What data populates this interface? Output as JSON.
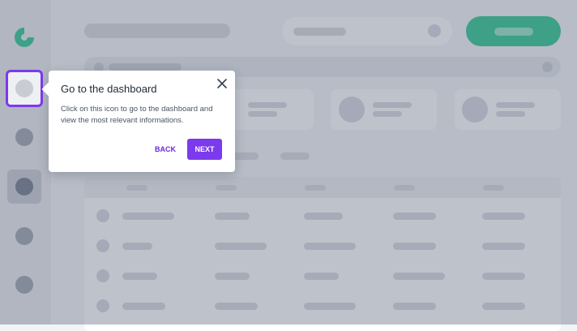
{
  "tour": {
    "title": "Go to the dashboard",
    "description": "Click on this icon to go to the dashboard and view the most relevant informations.",
    "back_label": "BACK",
    "next_label": "NEXT"
  },
  "colors": {
    "accent": "#7c3aed",
    "logo": "#22c58b",
    "primary_button": "#22c58b"
  },
  "icons": {
    "logo": "app-logo",
    "close": "close-icon"
  },
  "sidebar": {
    "highlighted_item": "dashboard",
    "active_item": 3
  }
}
